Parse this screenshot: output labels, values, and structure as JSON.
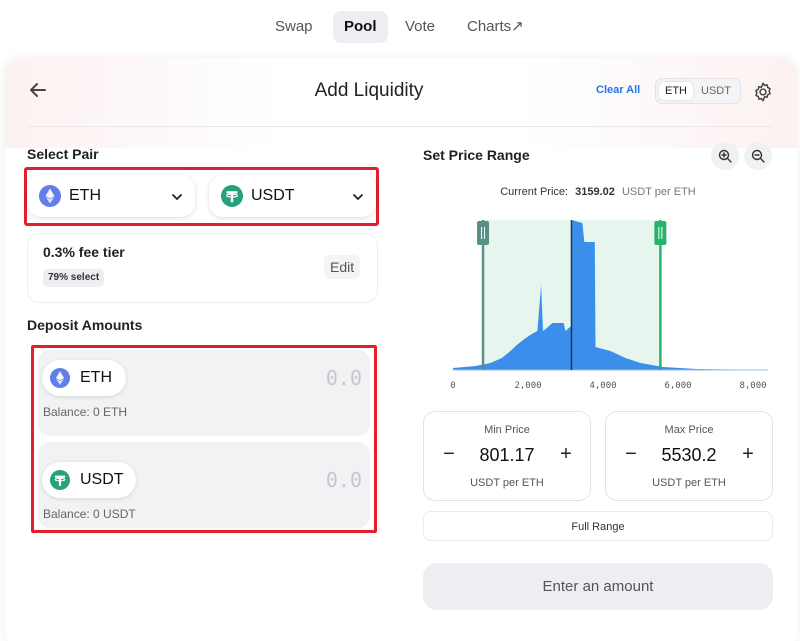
{
  "nav": {
    "tabs": [
      {
        "label": "Swap"
      },
      {
        "label": "Pool"
      },
      {
        "label": "Vote"
      },
      {
        "label": "Charts↗"
      }
    ]
  },
  "header": {
    "title": "Add Liquidity",
    "clear_all": "Clear All",
    "currency_options": [
      "ETH",
      "USDT"
    ]
  },
  "select_pair": {
    "label": "Select Pair",
    "token_a": {
      "symbol": "ETH",
      "icon": "eth-icon"
    },
    "token_b": {
      "symbol": "USDT",
      "icon": "usdt-icon"
    },
    "fee_tier": "0.3% fee tier",
    "fee_badge": "79% select",
    "edit": "Edit"
  },
  "deposit": {
    "label": "Deposit Amounts",
    "items": [
      {
        "symbol": "ETH",
        "amount": "0.0",
        "balance": "Balance: 0 ETH"
      },
      {
        "symbol": "USDT",
        "amount": "0.0",
        "balance": "Balance: 0 USDT"
      }
    ]
  },
  "price_range": {
    "label": "Set Price Range",
    "current_price_label": "Current Price:",
    "current_price_value": "3159.02",
    "current_price_unit": "USDT per ETH",
    "min": {
      "label": "Min Price",
      "value": "801.17",
      "unit": "USDT per ETH"
    },
    "max": {
      "label": "Max Price",
      "value": "5530.2",
      "unit": "USDT per ETH"
    },
    "full_range": "Full Range",
    "minus": "−",
    "plus": "+"
  },
  "chart_data": {
    "type": "area",
    "x_ticks": [
      "0",
      "2,000",
      "4,000",
      "6,000",
      "8,000"
    ],
    "xlim": [
      0,
      8400
    ],
    "current_price": 3159.02,
    "range_min": 801.17,
    "range_max": 5530.2
  },
  "action": {
    "label": "Enter an amount"
  },
  "colors": {
    "accent": "#1f75e6",
    "liquidity": "#3b8fea",
    "range_fill": "#e7f5ef",
    "range_min_handle": "#5a8f83",
    "range_max_handle": "#29b36a",
    "highlight_box": "#e0212d",
    "eth": "#627eea",
    "usdt": "#26a17b"
  }
}
